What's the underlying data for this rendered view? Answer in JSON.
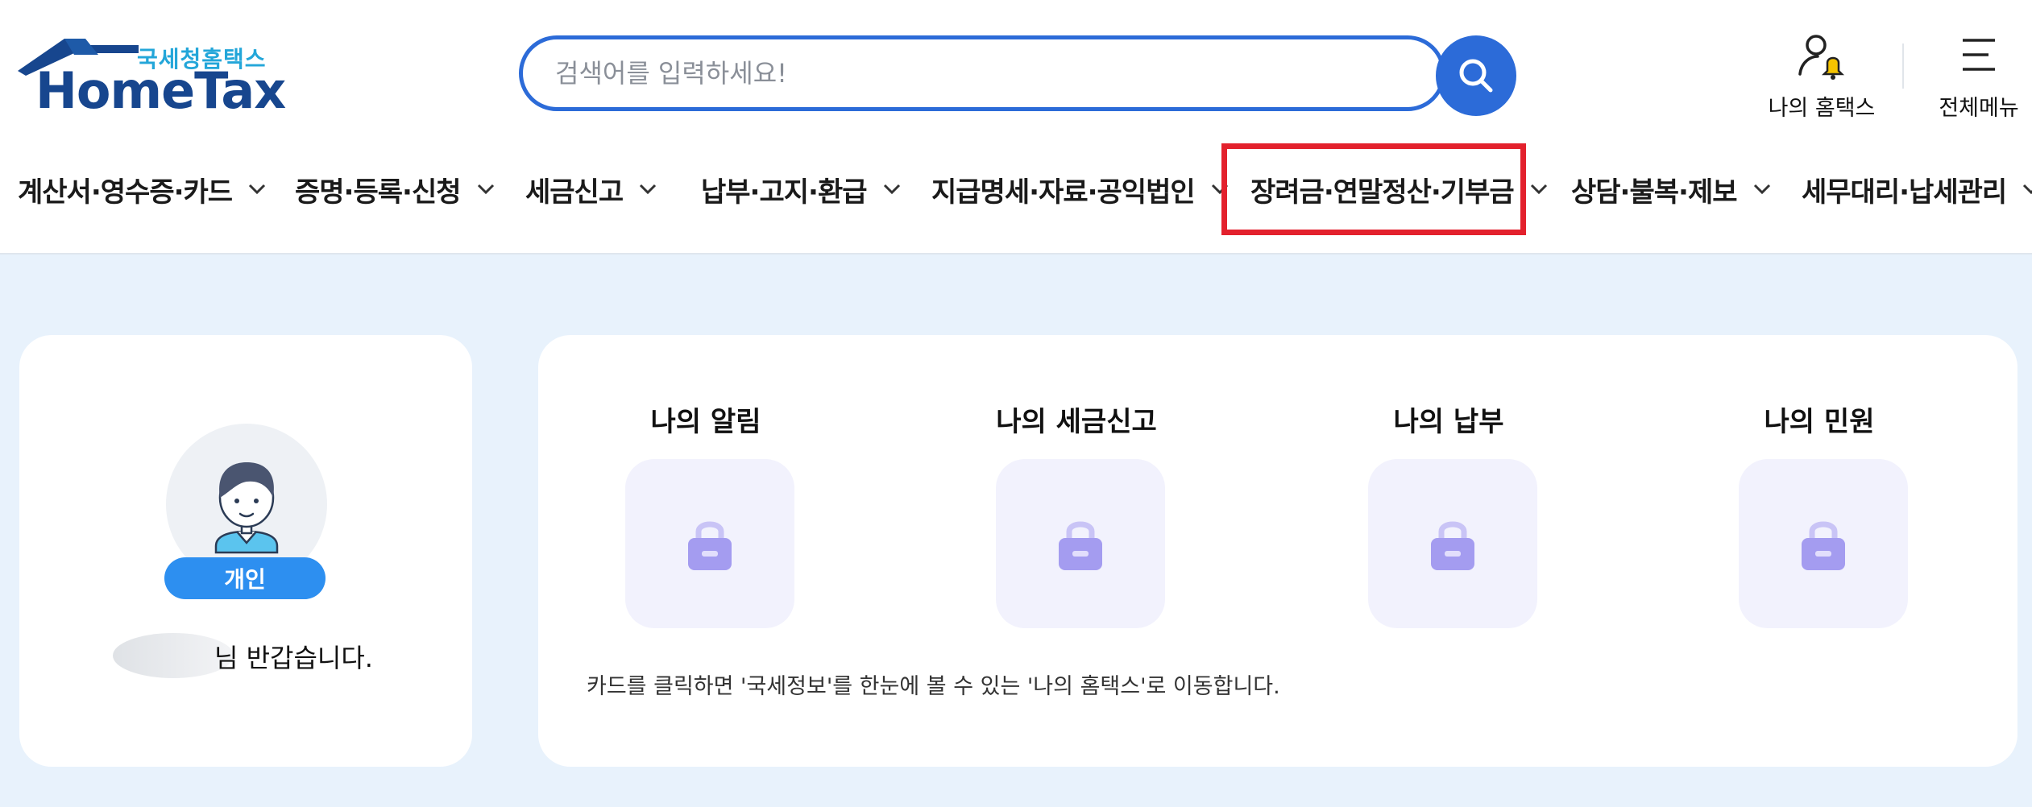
{
  "logo": {
    "sub": "국세청홈택스",
    "main": "HomeTax"
  },
  "search": {
    "placeholder": "검색어를 입력하세요!",
    "icon": "search-icon"
  },
  "utils": [
    {
      "label": "나의 홈택스",
      "icon": "user-bell-icon"
    },
    {
      "label": "전체메뉴",
      "icon": "hamburger-menu-icon"
    }
  ],
  "nav": [
    {
      "label": "계산서·영수증·카드"
    },
    {
      "label": "증명·등록·신청"
    },
    {
      "label": "세금신고"
    },
    {
      "label": "납부·고지·환급"
    },
    {
      "label": "지급명세·자료·공익법인"
    },
    {
      "label": "장려금·연말정산·기부금",
      "highlighted": true
    },
    {
      "label": "상담·불복·제보"
    },
    {
      "label": "세무대리·납세관리"
    }
  ],
  "profile": {
    "badge": "개인",
    "greeting": "님 반갑습니다."
  },
  "my": {
    "cards": [
      {
        "title": "나의 알림",
        "icon": "lock-icon"
      },
      {
        "title": "나의 세금신고",
        "icon": "lock-icon"
      },
      {
        "title": "나의 납부",
        "icon": "lock-icon"
      },
      {
        "title": "나의 민원",
        "icon": "lock-icon"
      }
    ],
    "note": "카드를 클릭하면 '국세정보'를 한눈에 볼 수 있는 '나의 홈택스'로 이동합니다."
  },
  "colors": {
    "brand": "#17468e",
    "accent": "#2c6bd8",
    "highlight": "#e3212d",
    "lock": "#a49cf0",
    "background": "#e8f2fc"
  }
}
